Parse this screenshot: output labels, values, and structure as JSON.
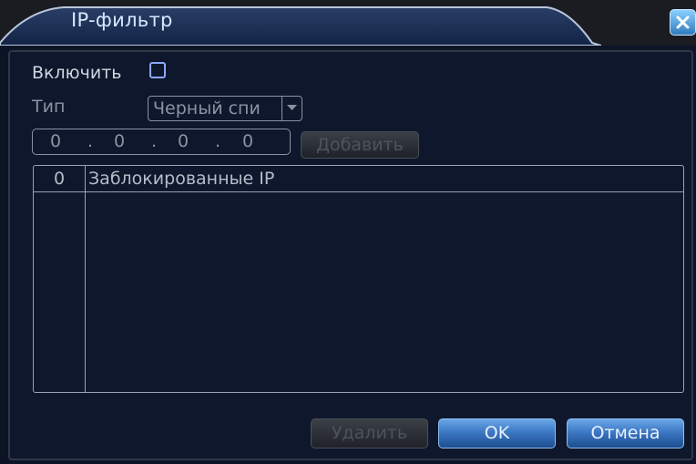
{
  "window": {
    "title": "IP-фильтр"
  },
  "form": {
    "enable_label": "Включить",
    "enable_checked": false,
    "type_label": "Тип",
    "type_value": "Черный спи",
    "ip_octets": [
      "0",
      "0",
      "0",
      "0"
    ],
    "ip_separator": ".",
    "add_button": "Добавить"
  },
  "table": {
    "headers": [
      "0",
      "Заблокированные IP"
    ],
    "rows": []
  },
  "footer": {
    "delete_button": "Удалить",
    "ok_button": "OK",
    "cancel_button": "Отмена"
  },
  "colors": {
    "background": "#0e172b",
    "accent": "#3d78c4",
    "text": "#cfd6e2"
  }
}
